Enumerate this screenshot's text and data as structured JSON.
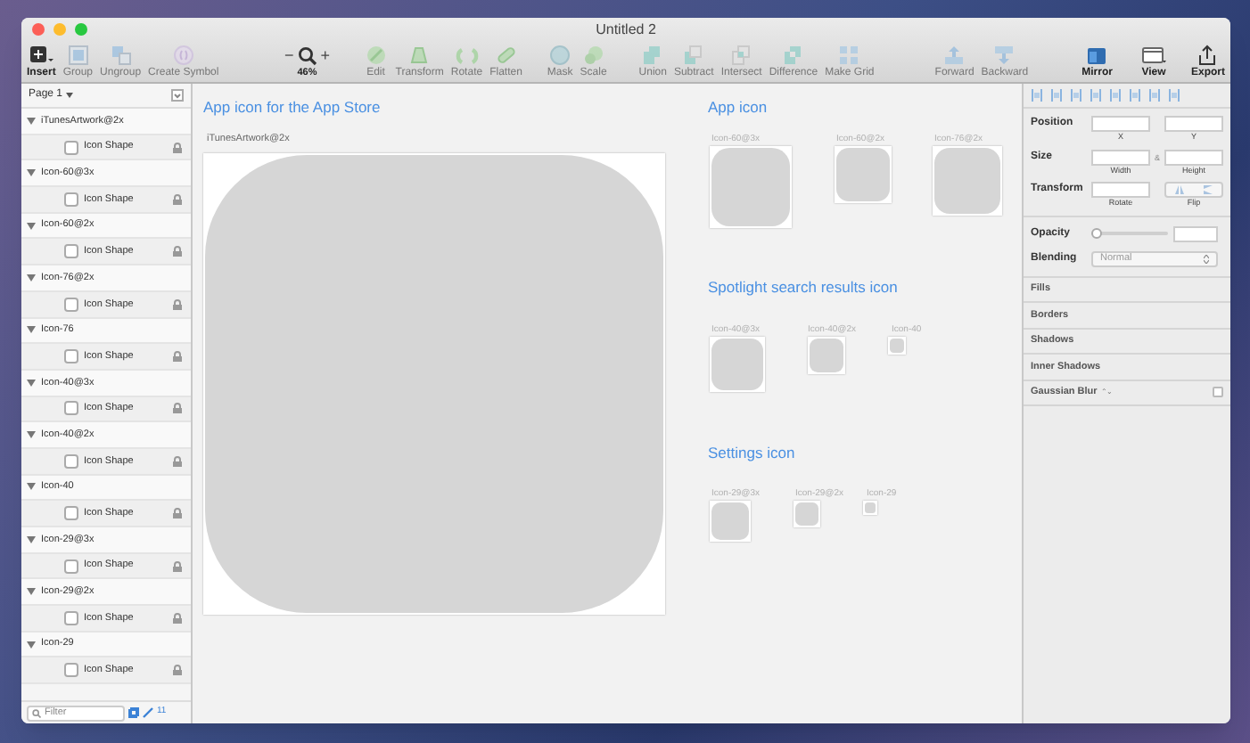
{
  "window": {
    "title": "Untitled 2"
  },
  "toolbar": [
    {
      "kind": "button",
      "label": "Insert",
      "disabled": false
    },
    {
      "kind": "button",
      "label": "Group",
      "disabled": true
    },
    {
      "kind": "button",
      "label": "Ungroup",
      "disabled": true
    },
    {
      "kind": "button",
      "label": "Create Symbol",
      "disabled": true
    },
    {
      "kind": "zoom",
      "minus": "−",
      "plus": "+",
      "label": "46%",
      "disabled": false
    },
    {
      "kind": "button",
      "label": "Edit",
      "disabled": true
    },
    {
      "kind": "button",
      "label": "Transform",
      "disabled": true
    },
    {
      "kind": "button",
      "label": "Rotate",
      "disabled": true
    },
    {
      "kind": "button",
      "label": "Flatten",
      "disabled": true
    },
    {
      "kind": "button",
      "label": "Mask",
      "disabled": true
    },
    {
      "kind": "button",
      "label": "Scale",
      "disabled": true
    },
    {
      "kind": "button",
      "label": "Union",
      "disabled": true
    },
    {
      "kind": "button",
      "label": "Subtract",
      "disabled": true
    },
    {
      "kind": "button",
      "label": "Intersect",
      "disabled": true
    },
    {
      "kind": "button",
      "label": "Difference",
      "disabled": true
    },
    {
      "kind": "button",
      "label": "Make Grid",
      "disabled": true
    },
    {
      "kind": "button",
      "label": "Forward",
      "disabled": true
    },
    {
      "kind": "button",
      "label": "Backward",
      "disabled": true
    },
    {
      "kind": "button",
      "label": "Mirror",
      "disabled": false
    },
    {
      "kind": "button",
      "label": "View",
      "disabled": false
    },
    {
      "kind": "button",
      "label": "Export",
      "disabled": false
    }
  ],
  "sidebar": {
    "page": "Page 1",
    "filter_placeholder": "Filter",
    "layer_count": "11",
    "layers": [
      {
        "name": "iTunesArtwork@2x",
        "expanded": true,
        "children": [
          {
            "name": "Icon Shape",
            "locked": true
          }
        ]
      },
      {
        "name": "Icon-60@3x",
        "expanded": true,
        "children": [
          {
            "name": "Icon Shape",
            "locked": true
          }
        ]
      },
      {
        "name": "Icon-60@2x",
        "expanded": true,
        "children": [
          {
            "name": "Icon Shape",
            "locked": true
          }
        ]
      },
      {
        "name": "Icon-76@2x",
        "expanded": true,
        "children": [
          {
            "name": "Icon Shape",
            "locked": true
          }
        ]
      },
      {
        "name": "Icon-76",
        "expanded": true,
        "children": [
          {
            "name": "Icon Shape",
            "locked": true
          }
        ]
      },
      {
        "name": "Icon-40@3x",
        "expanded": true,
        "children": [
          {
            "name": "Icon Shape",
            "locked": true
          }
        ]
      },
      {
        "name": "Icon-40@2x",
        "expanded": true,
        "children": [
          {
            "name": "Icon Shape",
            "locked": true
          }
        ]
      },
      {
        "name": "Icon-40",
        "expanded": true,
        "children": [
          {
            "name": "Icon Shape",
            "locked": true
          }
        ]
      },
      {
        "name": "Icon-29@3x",
        "expanded": true,
        "children": [
          {
            "name": "Icon Shape",
            "locked": true
          }
        ]
      },
      {
        "name": "Icon-29@2x",
        "expanded": true,
        "children": [
          {
            "name": "Icon Shape",
            "locked": true
          }
        ]
      },
      {
        "name": "Icon-29",
        "expanded": true,
        "children": [
          {
            "name": "Icon Shape",
            "locked": true
          }
        ]
      }
    ]
  },
  "canvas": {
    "sections": [
      {
        "title": "App icon for the App Store",
        "artboards": [
          {
            "label": "iTunesArtwork@2x"
          }
        ]
      },
      {
        "title": "App icon",
        "artboards": [
          {
            "label": "Icon-60@3x"
          },
          {
            "label": "Icon-60@2x"
          },
          {
            "label": "Icon-76@2x"
          }
        ]
      },
      {
        "title": "Spotlight search results icon",
        "artboards": [
          {
            "label": "Icon-40@3x"
          },
          {
            "label": "Icon-40@2x"
          },
          {
            "label": "Icon-40"
          }
        ]
      },
      {
        "title": "Settings icon",
        "artboards": [
          {
            "label": "Icon-29@3x"
          },
          {
            "label": "Icon-29@2x"
          },
          {
            "label": "Icon-29"
          }
        ]
      }
    ]
  },
  "inspector": {
    "position": {
      "label": "Position",
      "x": "X",
      "y": "Y"
    },
    "size": {
      "label": "Size",
      "width": "Width",
      "link": "&",
      "height": "Height"
    },
    "transform": {
      "label": "Transform",
      "rotate": "Rotate",
      "flip": "Flip"
    },
    "opacity": {
      "label": "Opacity",
      "level": 0
    },
    "blending": {
      "label": "Blending",
      "value": "Normal"
    },
    "sections": [
      {
        "label": "Fills"
      },
      {
        "label": "Borders"
      },
      {
        "label": "Shadows"
      },
      {
        "label": "Inner Shadows"
      },
      {
        "label": "Gaussian Blur",
        "stepper": "⌃⌄",
        "checked": false
      }
    ]
  }
}
